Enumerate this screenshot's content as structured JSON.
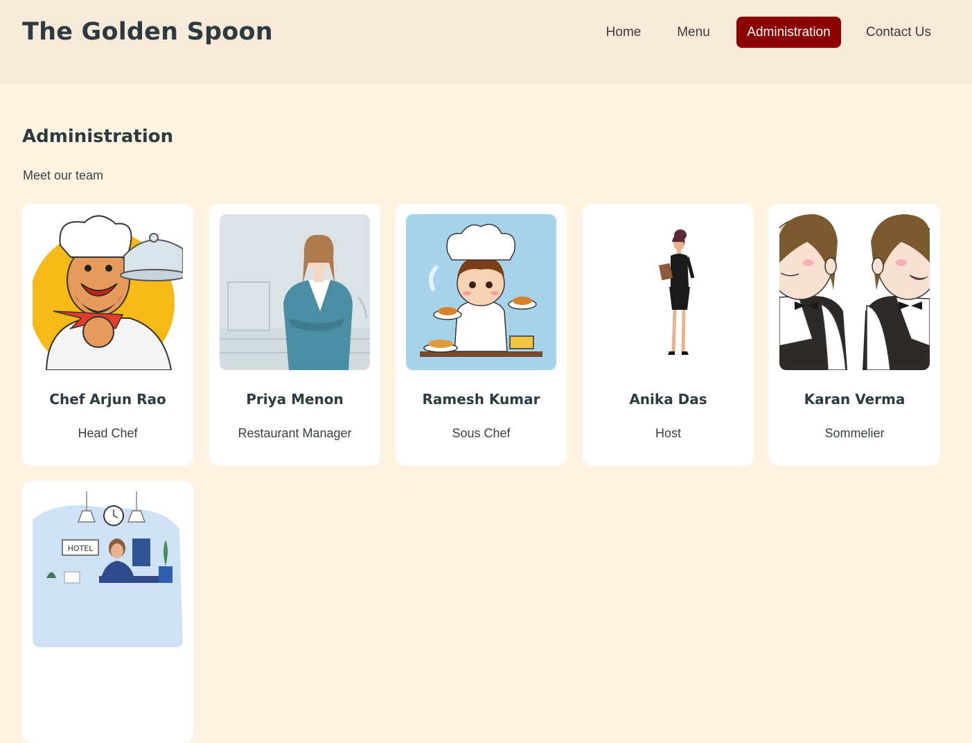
{
  "brand": "The Golden Spoon",
  "nav": [
    {
      "label": "Home"
    },
    {
      "label": "Menu"
    },
    {
      "label": "Administration",
      "active": true
    },
    {
      "label": "Contact Us"
    }
  ],
  "page": {
    "title": "Administration",
    "subtitle": "Meet our team"
  },
  "team": [
    {
      "name": "Chef Arjun Rao",
      "role": "Head Chef"
    },
    {
      "name": "Priya Menon",
      "role": "Restaurant Manager"
    },
    {
      "name": "Ramesh Kumar",
      "role": "Sous Chef"
    },
    {
      "name": "Anika Das",
      "role": "Host"
    },
    {
      "name": "Karan Verma",
      "role": "Sommelier"
    },
    {
      "name": "",
      "role": "",
      "photo_text": "HOTEL"
    }
  ],
  "colors": {
    "accent": "#8b0000",
    "page_bg": "#fef3e0",
    "header_bg": "#f8ead9",
    "card_bg": "#ffffff"
  }
}
